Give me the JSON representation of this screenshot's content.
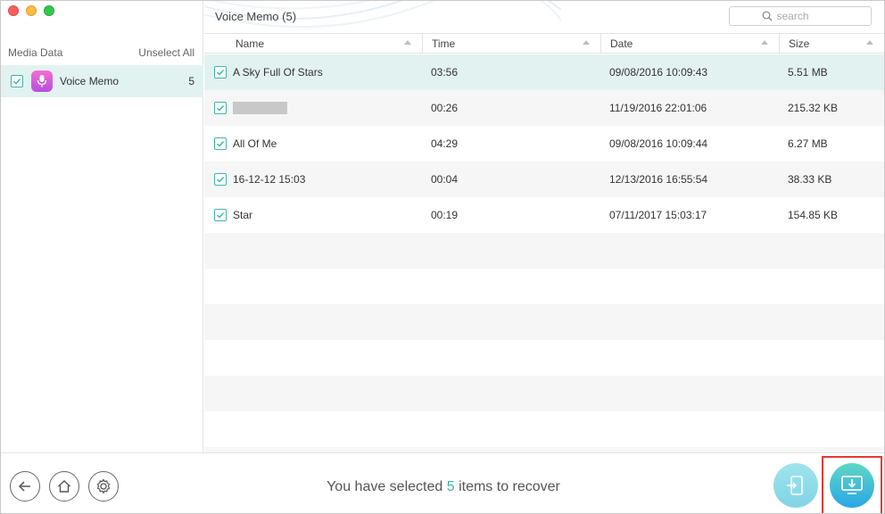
{
  "sidebar": {
    "header_label": "Media Data",
    "unselect_label": "Unselect All",
    "items": [
      {
        "label": "Voice Memo",
        "count": "5",
        "icon": "microphone-icon",
        "checked": true
      }
    ]
  },
  "main": {
    "title": "Voice Memo (5)",
    "search_placeholder": "search",
    "columns": {
      "name": "Name",
      "time": "Time",
      "date": "Date",
      "size": "Size"
    },
    "rows": [
      {
        "name": "A Sky Full Of Stars",
        "time": "03:56",
        "date": "09/08/2016 10:09:43",
        "size": "5.51 MB",
        "checked": true
      },
      {
        "name": "",
        "time": "00:26",
        "date": "11/19/2016 22:01:06",
        "size": "215.32 KB",
        "checked": true
      },
      {
        "name": "All Of Me",
        "time": "04:29",
        "date": "09/08/2016 10:09:44",
        "size": "6.27 MB",
        "checked": true
      },
      {
        "name": "16-12-12 15:03",
        "time": "00:04",
        "date": "12/13/2016 16:55:54",
        "size": "38.33 KB",
        "checked": true
      },
      {
        "name": "Star",
        "time": "00:19",
        "date": "07/11/2017 15:03:17",
        "size": "154.85 KB",
        "checked": true
      }
    ]
  },
  "footer": {
    "status_prefix": "You have selected ",
    "status_count": "5",
    "status_suffix": " items to recover"
  },
  "colors": {
    "accent": "#3fb6a8",
    "selected_row": "#e2f2f0",
    "highlight": "#e53935"
  }
}
